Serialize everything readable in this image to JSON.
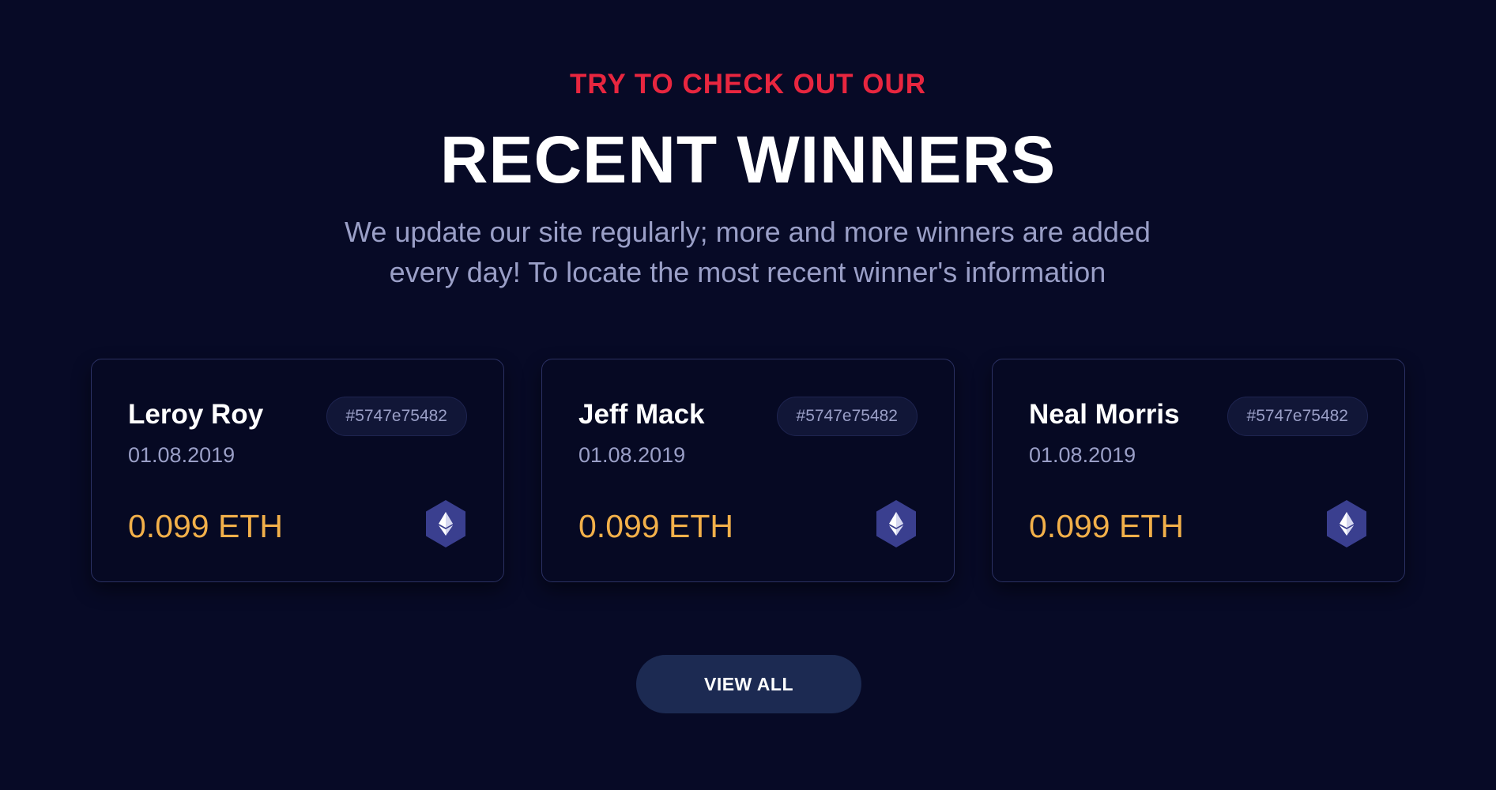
{
  "header": {
    "eyebrow": "TRY TO CHECK OUT OUR",
    "title": "RECENT WINNERS",
    "subtitle": "We update our site regularly; more and more winners are added every day! To locate the most recent winner's information"
  },
  "winners": [
    {
      "name": "Leroy Roy",
      "date": "01.08.2019",
      "id": "#5747e75482",
      "amount": "0.099 ETH",
      "icon": "ethereum-icon"
    },
    {
      "name": "Jeff Mack",
      "date": "01.08.2019",
      "id": "#5747e75482",
      "amount": "0.099 ETH",
      "icon": "ethereum-icon"
    },
    {
      "name": "Neal Morris",
      "date": "01.08.2019",
      "id": "#5747e75482",
      "amount": "0.099 ETH",
      "icon": "ethereum-icon"
    }
  ],
  "actions": {
    "view_all_label": "VIEW ALL"
  },
  "colors": {
    "background": "#070a26",
    "accent_red": "#e8263f",
    "amount_gold": "#f2b04a",
    "muted_text": "#9a9fc7",
    "button_bg": "#1c2a52",
    "eth_badge": "#3a3f8f"
  }
}
